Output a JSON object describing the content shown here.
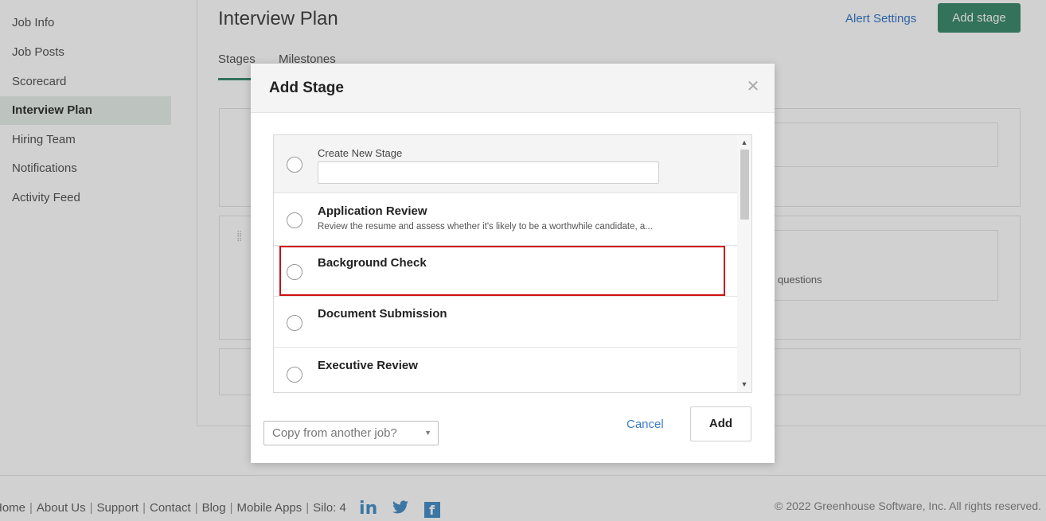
{
  "sidebar": {
    "items": [
      {
        "label": "Job Info"
      },
      {
        "label": "Job Posts"
      },
      {
        "label": "Scorecard"
      },
      {
        "label": "Interview Plan"
      },
      {
        "label": "Hiring Team"
      },
      {
        "label": "Notifications"
      },
      {
        "label": "Activity Feed"
      }
    ],
    "active": "Interview Plan"
  },
  "header": {
    "title": "Interview Plan",
    "alert_settings": "Alert Settings",
    "add_stage": "Add stage"
  },
  "tabs": [
    {
      "label": "Stages"
    },
    {
      "label": "Milestones"
    }
  ],
  "background": {
    "questions_text": "questions"
  },
  "modal": {
    "title": "Add Stage",
    "close_icon": "close-icon",
    "create_label": "Create New Stage",
    "create_value": "",
    "stages": [
      {
        "name": "Application Review",
        "description": "Review the resume and assess whether it's likely to be a worthwhile candidate, a..."
      },
      {
        "name": "Background Check",
        "description": ""
      },
      {
        "name": "Document Submission",
        "description": ""
      },
      {
        "name": "Executive Review",
        "description": ""
      }
    ],
    "copy_select": "Copy from another job?",
    "cancel": "Cancel",
    "add": "Add"
  },
  "footer": {
    "links": [
      "Home",
      "About Us",
      "Support",
      "Contact",
      "Blog",
      "Mobile Apps",
      "Silo: 4"
    ],
    "copyright": "© 2022 Greenhouse Software, Inc. All rights reserved.",
    "social_icons": [
      "linkedin-icon",
      "twitter-icon",
      "facebook-icon"
    ]
  },
  "colors": {
    "brand_green": "#3f8c6f",
    "link_blue": "#3a7bc8",
    "highlight_red": "#d01010"
  }
}
